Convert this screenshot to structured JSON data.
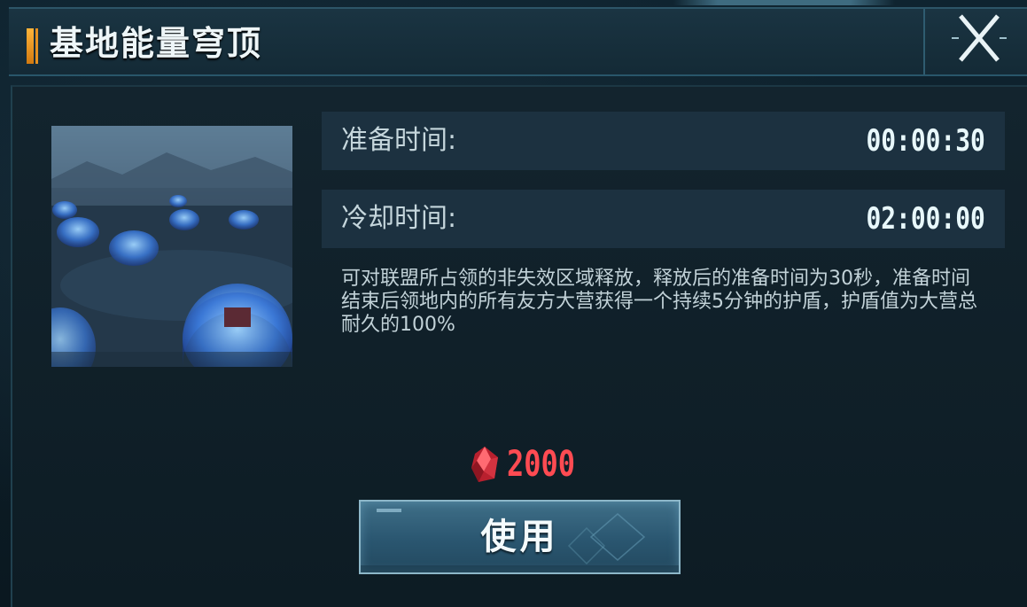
{
  "dialog": {
    "title": "基地能量穹顶",
    "close_icon": "close-x-icon"
  },
  "skill": {
    "image_icon": "energy-dome-image",
    "prep_label": "准备时间:",
    "prep_value": "00:00:30",
    "cooldown_label": "冷却时间:",
    "cooldown_value": "02:00:00",
    "description": "可对联盟所占领的非失效区域释放，释放后的准备时间为30秒，准备时间结束后领地内的所有友方大营获得一个持续5分钟的护盾，护盾值为大营总耐久的100%"
  },
  "cost": {
    "icon": "red-crystal-icon",
    "amount": "2000",
    "color": "#ff4b52"
  },
  "actions": {
    "use_label": "使用"
  },
  "colors": {
    "accent": "#ffb43a",
    "button": "#2a5670"
  }
}
